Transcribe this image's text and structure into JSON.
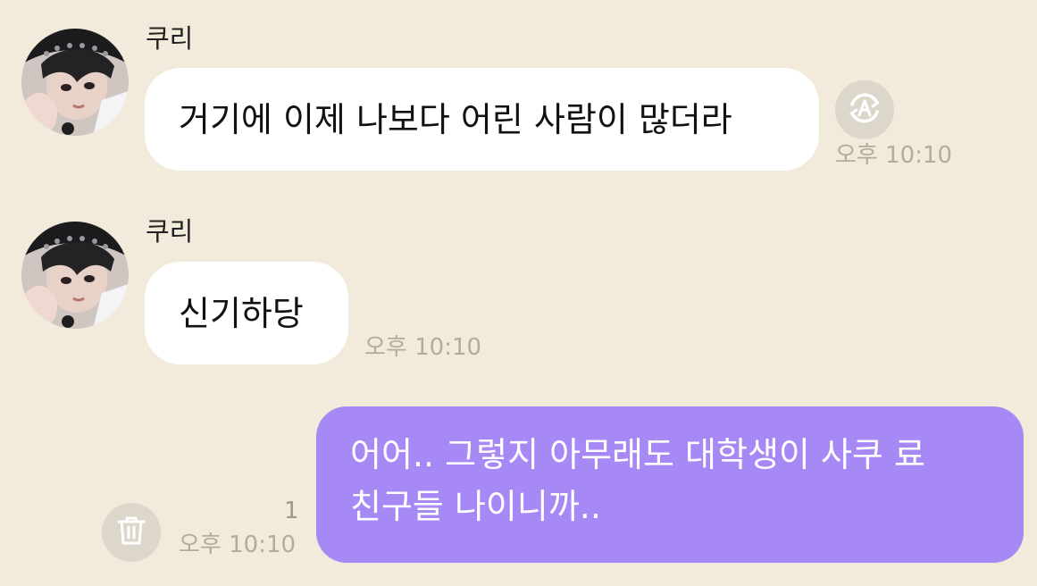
{
  "messages": [
    {
      "sender": "쿠리",
      "text": "거기에 이제 나보다 어린 사람이 많더라",
      "time": "오후 10:10",
      "translate_icon": "auto-translate-icon"
    },
    {
      "sender": "쿠리",
      "text": "신기하당",
      "time": "오후 10:10"
    },
    {
      "text_line1": "어어.. 그렇지 아무래도 대학생이 사쿠 료",
      "text_line2": "친구들 나이니까..",
      "time": "오후 10:10",
      "unread_count": "1",
      "delete_icon": "trash-icon"
    }
  ],
  "colors": {
    "background": "#f2eadb",
    "incoming_bubble": "#ffffff",
    "outgoing_bubble": "#a689f5",
    "timestamp": "#b4ab9b"
  }
}
